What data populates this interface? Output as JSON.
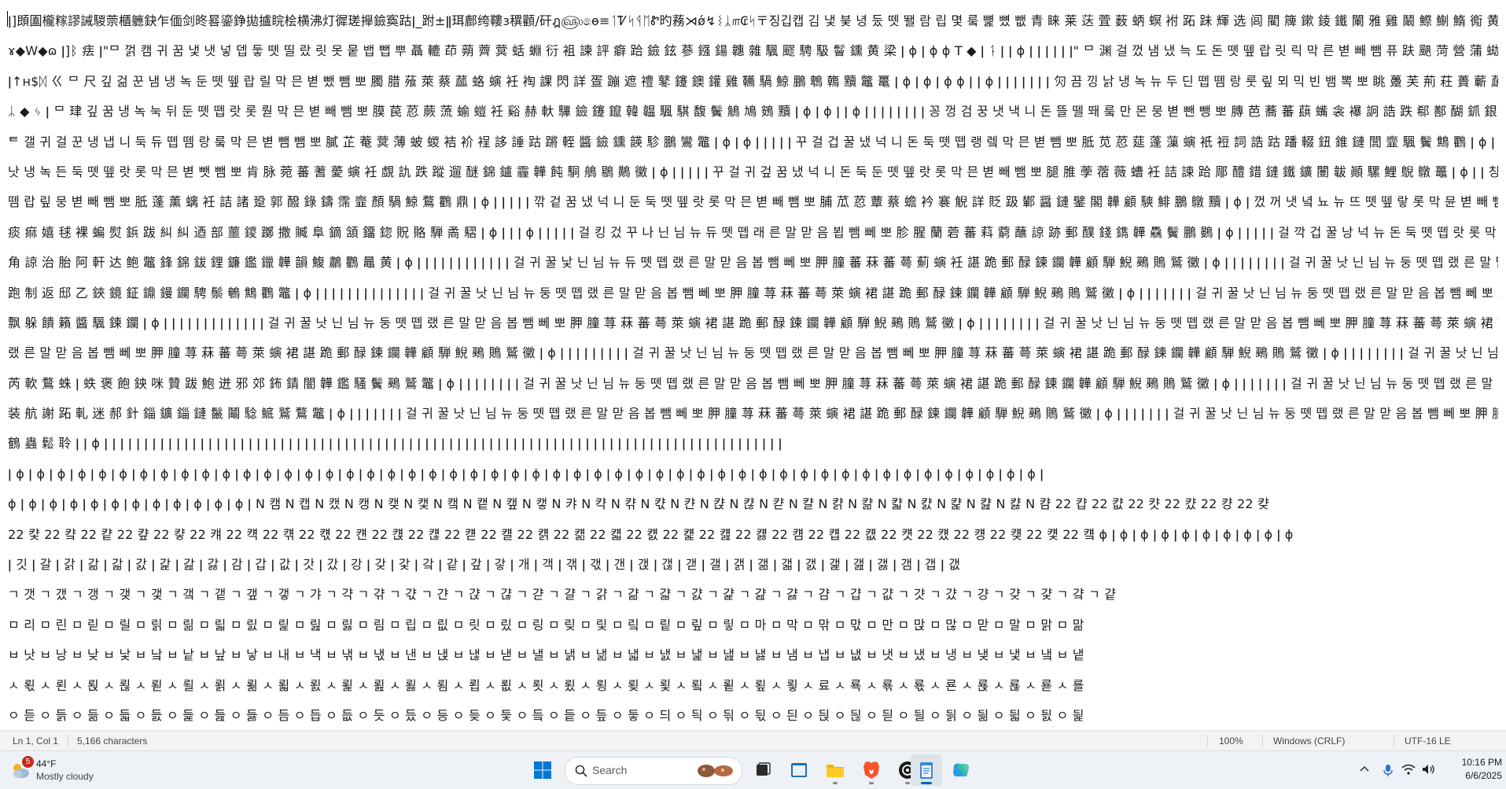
{
  "editor": {
    "lines": [
      "ǀ]䫀圔櫳糘謬誡騣萗櫃軈鈌乍偭剑昸晷鎏錚拋攎睆桧横沸灯徲瑳攑鐱寏跍ǀ_跗±ǁ珥鄜绔鞻ɜ穓顴/矸ฎ௵෧ɵ≡ᛐᏤᛋᛩᛖᏑ旳蓩⋊ǿ↯ᛵᛣ௱₢ᛋ〒징깁캡 김 냋 붖 녕 둤 뗏 뙐 람 립 몇 뤀 뼕 뼜 뺎 青 睐 莱 荙 萓 薮 蛃 螟 袝 跖 跊 輝 选 闾 閵 簰 鏉 錂 鐵 閳 雅 雞 鬫 鰶 鯯 鰖 鵆 黄 峡 ɸ ǀ ǿ ǿ ɸ",
      "ɤ◆W◆ɷ ǀ]ᛒ 㾀 ǀ\"ᄆ 껅 캠 귀 꿈 냋 냇 넣 뎁 둫 뗏 띨 랐 릿 못 뭍 뱁 뺍 뿌 聶 轆 茚 蒴 薺 蓂 蛞 蜵 衍 袓 諫 評 癖 跲 鐱 鉉 蔘 鏹 鍚 韢 雜 颿 飂 騁 馺 鬙 鑂 黄 梁 ǀ ɸ ǀ ɸ ɸ T ◆ ǀ ᛑ ǀ ǀ ɸ ǀ ǀ ǀ ǀ ǀ ǀ\" ᄆ 渊 걸 껐 냄 냈 늑 도 돈 뗏 뗖 랍 릿 릭 막 른 볃 빼 뺌 퓨 趺 颶 菏 營 蒲 蜐 蝂 婐 衾 裮 週 郙 諄 新 蹯 鈊 錦 鍜 雅 鐮 颿 騏 鬟 鶈 鷄 黔 稀",
      "ǀ↑ʜ$ᛞ ㄍ ᄆ 尺 깊 걺 꾼 냄 냉 녹 둔 뗏 뗖 랍 릴 막 믄 볃 뺐 뺌 뽀 臅 腊 蕵 萊 蔡 蓏 蛒 螾 衽 裪 課 閃 詳 疍 蹦 遮 禮 鼕 鑳 鐭 鑵 雞 韉 騧 鯨 鵬 鵯 鶾 黷 鼈 鼍 ǀ ɸ ǀ ɸ ǀ ɸ ɸ ǀ ǀ ɸ ǀ ǀ ǀ ǀ ǀ ǀ ǀ 灳 끔 낑 낡 냉 녹 뉴 두 딘 뗍 뗌 랑 룻 맆 뫼 믹 빈 뱀 뽁 뽀 眺 躉 芙 荊 荰 蕢 蘄 蓏 蝵 衲 讁 謹 謝 賛 趄 跨 軏 鐼 镞 鏇 鐫 閣 驊 韡 餺 鯛 鸚 鱝 鳥 黶 ǀ ɸ ǀ ɸ ǀ",
      "ᛦ ◆ ᛃ ǀ ᄆ 珒 깊 꿈 냉 녹 눅 뒤 둔 뗏 뗍 랏 롯 뤋 막 믄 볃 빼 뺌 뽀 膜 苠 荵 蕨 蓅 蝓 螘 衽 谿 赫 軑 驆 鐱 鑳 鑹 韓 韞 颿 騏 馥 鬢 鵤 鳩 鴳 黷 ǀ ɸ ǀ ɸ ǀ ǀ ɸ ǀ ǀ ǀ ǀ ǀ ǀ ǀ ǀ 꽁 껑 검 꿍 냇 낵 니 돈 뜰 뗄 뙈 뤀 만 몬 뭉 볃 뺀 뺑 뽀 膞 芭 蕎 蕃 蕻 蟕 衾 襮 詗 誥 跌 郗 鄯 醐 釽 銀 錬 鑅 閭 韡 顚 駒 鯬 鴉 鵷 黏 ǀ ɸ ǀ ɸ ǀ",
      "ᄐ 갤 귀 걸 꾼 냉 냅 니 둑 듀 뗍 뗌 랑 뤀 막 믄 볃 뺌 뺌 뽀 膩 芷 菴 蓂 薄 蚾 蝬 袺 衸 裎 誃 諈 跍 蹡 輊 醬 鐱 鑂 韺 駗 鵬 鸞 鼈 ǀ ɸ ǀ ɸ ǀ ǀ ǀ ǀ ǀ 꾸 걸 겁 꿀 냈 넉 니 돈 둑 뗏 뗍 랭 렠 막 믄 볃 뺌 뽀 胝 苋 荵 莚 蓬 薻 螾 衹 裋 詞 誥 跍 蹯 輟 鈕 錐 鏈 閭 韲 颿 鬢 鷦 鸜 ǀ ɸ ǀ ǀ ǀ ǀ ǀ ǀ ǀ 끌 깍 귀 꿈",
      "낫 냉 녹 든 둑 뗏 뗖 랏 롯 막 믄 볃 뺏 뺌 뽀 肯 脉 菀 蕃 蓍 薆 螾 衽 覷 訅 跌 蹤 遛 醚 錦 鑪 霾 韡 飩 駧 鵃 鶍 鷬 黴 ǀ ɸ ǀ ǀ ǀ ǀ ǀ 꾸 걸 귀 겊 꿈 냈 넉 니 돈 둑 둔 뗏 뗖 랏 롯 막 믄 볃 빼 뺌 뽀 腿 脽 荸 蓿 薇 螬 衽 詰 諫 跲 郮 醴 錯 鏈 鐵 鑛 闦 韍 顚 騾 鯉 鶃 鷻 鼉 ǀ ɸ ǀ ǀ 칭 꿀 겁 깐 낙 녹 뉴 도 등 뗏",
      "뗌 랍 맆 뭉 볃 빼 뺌 뽀 胝 蓬 薰 螭 衽 詰 諸 跫 郭 醱 錄 鑄 霈 韲 顏 騧 鯨 鶩 鸜 鼎 ǀ ɸ ǀ ǀ ǀ ǀ ǀ 깎 겉 꿈 냈 넉 니 둔 둑 뗏 뗖 랏 롯 막 믄 볃 빼 뺌 뽀 脯 苽 荵 蕈 蔡 蟾 衿 褰 觬 詳 貶 趿 鄻 醤 鏈 鐾 閣 韡 顧 騻 鯡 鵬 鷻 黷 ǀ ɸ ǀ 껐 꺼 냇 녘 뇨 뉴 뜨 뗏 뗖 랗 롯 막 뮨 볃 빼 뺌 뽀 膽 腥 菁 蕃 萍 螢 褞 豚 輟 鐱 鑑",
      "痰 痲 嬉 毬 裸 蝙 熨 鋲 跋 糾 糾 迺 部 蘁 鑁 躑 撒 贓 阜 鏑 頷 鐂 鍃 貺 賂 騨 矞 騽 ǀ ɸ ǀ ǀ ǀ ɸ ǀ ǀ ǀ ǀ ǀ 걸 킹 겄 꾸 나 닌 님 뉴 듀 뗏 뗍 래 른 말 맏 음 뵙 뺌 뻬 뽀 胗 腥 蘭 菪 蕃 萪 藭 蘸 諒 跡 郵 醭 錢 鐫 韡 驫 鬢 鵬 鷃 ǀ ɸ ǀ ǀ ǀ ǀ ǀ 걸 깍 겁 꿀 낭 넉 뉴 돈 둑 뗏 뗍 랏 롯 막 믄 볃 빼 뺌 뽀 胝 苠 菽 蓍 蕖 螗 衽 諧 跨 郭 鍪 霸 韉 騾 鴆 鶼 黻",
      "角 諒 治 胎 阿 軒 达 鲍 鼈 鋒 錦 鈸 鋰 鐮 鑑 鑞 韡 韻 鰒 鷫 鸜 鼂 黄 ǀ ɸ ǀ ǀ ǀ ǀ ǀ ǀ ǀ ǀ ǀ ǀ ǀ ǀ 걸 귀 꿀 낯 닌 님 뉴 듀 뗏 뗍 랬 른 말 맏 음 봅 뺌 뻬 뽀 胛 膧 蕃 菻 蕃 蕚 薊 螾 衽 諶 跪 郵 醁 鍊 鑭 韡 顧 騨 鯢 鵐 鵙 鷲 黴 ǀ ɸ ǀ ǀ ǀ ǀ ǀ ǀ ǀ ǀ 걸 귀 꿀 낫 닌 님 뉴 둥 뗏 뗍 랬 른 말 맏 음 봅 뺌 뻬 뽀 胛 膧 荨 菻 蕃 蕚 萊 螾 裙 諶 跪 郵 醁",
      "跑 制 返 邸 乙 鋏 鏡 鉦 鐤 鏝 鑭 騁 鬃 鵪 鷦 鸜 鼈 ǀ ɸ ǀ ǀ ǀ ǀ ǀ ǀ ǀ ǀ ǀ ǀ ǀ ǀ ǀ ǀ 걸 귀 꿀 낫 닌 님 뉴 둥 뗏 뗍 랬 른 말 맏 음 봅 뺌 뻬 뽀 胛 膧 荨 菻 蕃 蕚 萊 螾 裙 諶 跪 郵 醁 鍊 鑭 韡 顧 騨 鯢 鵐 鵙 鷲 黴 ǀ ɸ ǀ ǀ ǀ ǀ ǀ ǀ ǀ 걸 귀 꿀 낫 닌 님 뉴 둥 뗏 뗍 랬 른 말 맏 음 봅 뺌 뻬 뽀 胛 膧 荨 菻 蕃 蕚 萊 螾 裙",
      "飘 躲 饋 籟 醬 颿 鍊 鑭 ǀ ɸ ǀ ǀ ǀ ǀ ǀ ǀ ǀ ǀ ǀ ǀ ǀ ǀ ǀ 걸 귀 꿀 낫 닌 님 뉴 둥 뗏 뗍 랬 른 말 맏 음 봅 뺌 뻬 뽀 胛 膧 荨 菻 蕃 蕚 萊 螾 裙 諶 跪 郵 醁 鍊 鑭 韡 顧 騨 鯢 鵐 鵙 鷲 黴 ǀ ɸ ǀ ǀ ǀ ǀ ǀ ǀ ǀ ǀ 걸 귀 꿀 낫 닌 님 뉴 둥 뗏 뗍 랬 른 말 맏 음 봅 뺌 뻬 뽀 胛 膧 荨 菻 蕃 蕚 萊 螾 裙 諶 跪",
      "랬 른 말 맏 음 봅 뺌 뻬 뽀 胛 膧 荨 菻 蕃 蕚 萊 螾 裙 諶 跪 郵 醁 鍊 鑭 韡 顧 騨 鯢 鵐 鵙 鷲 黴 ǀ ɸ ǀ ǀ ǀ ǀ ǀ ǀ ǀ ǀ ǀ 걸 귀 꿀 낫 닌 님 뉴 둥 뗏 뗍 랬 른 말 맏 음 봅 뺌 뻬 뽀 胛 膧 荨 菻 蕃 蕚 萊 螾 裙 諶 跪 郵 醁 鍊 鑭 韡 顧 騨 鯢 鵐 鵙 鷲 黴 ǀ ɸ ǀ ǀ ǀ ǀ ǀ ǀ ǀ ǀ 걸 귀 꿀 낫 닌 님 뉴 둥 뗏",
      "芮 軟 鶩 蛛 ǀ 蛈 褒 飽 鉠 咪 贊 跋 鮑 迸 邪 郊 鈽 錆 闇 韡 鑑 騷 鬢 鵐 鷲 鼈 ǀ ɸ ǀ ǀ ǀ ǀ ǀ ǀ ǀ ǀ 걸 귀 꿀 낫 닌 님 뉴 둥 뗏 뗍 랬 른 말 맏 음 봅 뺌 뻬 뽀 胛 膧 荨 菻 蕃 蕚 萊 螾 裙 諶 跪 郵 醁 鍊 鑭 韡 顧 騨 鯢 鵐 鵙 鷲 黴 ǀ ɸ ǀ ǀ ǀ ǀ ǀ ǀ ǀ 걸 귀 꿀 낫 닌 님 뉴 둥 뗏 뗍 랬 른 말 맏 음",
      "装 航 謝 跖 軋 迷 郝 針 錙 鑛 錙 鏈 鬣 鬮 騐 鯳 鷲 鶩 鼈 ǀ ɸ ǀ ǀ ǀ ǀ ǀ ǀ ǀ 걸 귀 꿀 낫 닌 님 뉴 둥 뗏 뗍 랬 른 말 맏 음 봅 뺌 뻬 뽀 胛 膧 荨 菻 蕃 蕚 萊 螾 裙 諶 跪 郵 醁 鍊 鑭 韡 顧 騨 鯢 鵐 鵙 鷲 黴 ǀ ɸ ǀ ǀ ǀ ǀ ǀ ǀ ǀ 걸 귀 꿀 낫 닌 님 뉴 둥 뗏 뗍 랬 른 말 맏 음 봅 뺌 뻬 뽀 胛 膧 荨",
      "鶴 蟲 鬆 聆 ǀ ǀ ɸ ǀ ǀ ǀ ǀ ǀ ǀ ǀ ǀ ǀ ǀ ǀ ǀ ǀ ǀ ǀ ǀ ǀ ǀ ǀ ǀ ǀ ǀ ǀ ǀ ǀ ǀ ǀ ǀ ǀ ǀ ǀ ǀ ǀ ǀ ǀ ǀ ǀ ǀ ǀ ǀ ǀ ǀ ǀ ǀ ǀ ǀ ǀ ǀ ǀ ǀ ǀ ǀ ǀ ǀ ǀ ǀ ǀ ǀ ǀ ǀ ǀ ǀ ǀ ǀ ǀ ǀ ǀ ǀ ǀ ǀ ǀ ǀ ǀ ǀ ǀ ǀ ǀ ǀ ǀ ǀ ǀ ǀ ǀ ǀ ǀ",
      "ǀ ɸ ǀ ɸ ǀ ɸ ǀ ɸ ǀ ɸ ǀ ɸ ǀ ɸ ǀ ɸ ǀ ɸ ǀ ɸ ǀ ɸ ǀ ɸ ǀ ɸ ǀ ɸ ǀ ɸ ǀ ɸ ǀ ɸ ǀ ɸ ǀ ɸ ǀ ɸ ǀ ɸ ǀ ɸ ǀ ɸ ǀ ɸ ǀ ɸ ǀ ɸ ǀ ɸ ǀ ɸ ǀ ɸ ǀ ɸ ǀ ɸ ǀ ɸ ǀ ɸ ǀ ɸ ǀ ɸ ǀ ɸ ǀ ɸ ǀ ɸ ǀ ɸ ǀ ɸ ǀ ɸ ǀ ɸ ǀ ɸ ǀ ɸ ǀ ɸ ǀ ɸ ǀ ɸ ǀ ɸ ǀ ɸ ǀ ɸ ǀ",
      "ɸ ǀ ɸ ǀ ɸ ǀ ɸ ǀ ɸ ǀ ɸ ǀ ɸ ǀ ɸ ǀ ɸ ǀ ɸ ǀ ɸ ǀ ɸ ǀ N 캠 N 캡 N 캤 N 캥 N 캦 N 캧 N 캨 N 캩 N 캪 N 캫 N 캬 N 캭 N 캮 N 캯 N 캰 N 캱 N 캲 N 캳 N 캴 N 캵 N 캶 N 캷 N 캸 N 캹 N 캺 N 캻 N 캼 22 캽 22 캾 22 캿 22 컀 22 컁 22 컂",
      "22 컃 22 컄 22 컅 22 컆 22 컇 22 컈 22 컉 22 컊 22 컋 22 컌 22 컍 22 컎 22 컏 22 컐 22 컑 22 컒 22 컓 22 컔 22 컕 22 컖 22 컗 22 컘 22 컙 22 컚 22 컛 22 컜 22 컝 22 컞 22 컟 22 컠 ɸ ǀ ɸ ǀ ɸ ǀ ɸ ǀ ɸ ǀ ɸ ǀ ɸ ǀ ɸ ǀ ɸ ǀ ɸ",
      "ǀ 깃 ǀ 갈 ǀ 갉 ǀ 갊 ǀ 갋 ǀ 갌 ǀ 갍 ǀ 갎 ǀ 갏 ǀ 감 ǀ 갑 ǀ 값 ǀ 갓 ǀ 갔 ǀ 강 ǀ 갖 ǀ 갗 ǀ 갘 ǀ 같 ǀ 갚 ǀ 갛 ǀ 개 ǀ 객 ǀ 갞 ǀ 갟 ǀ 갠 ǀ 갡 ǀ 갢 ǀ 갣 ǀ 갤 ǀ 갥 ǀ 갦 ǀ 갧 ǀ 갨 ǀ 갩 ǀ 갪 ǀ 갫 ǀ 갬 ǀ 갭 ǀ 갮",
      "ㄱ 갯 ㄱ 갰 ㄱ 갱 ㄱ 갲 ㄱ 갳 ㄱ 갴 ㄱ 갵 ㄱ 갶 ㄱ 갷 ㄱ 갸 ㄱ 갹 ㄱ 갺 ㄱ 갻 ㄱ 갼 ㄱ 갽 ㄱ 갾 ㄱ 갿 ㄱ 걀 ㄱ 걁 ㄱ 걂 ㄱ 걃 ㄱ 걄 ㄱ 걅 ㄱ 걆 ㄱ 걇 ㄱ 걈 ㄱ 걉 ㄱ 걊 ㄱ 걋 ㄱ 걌 ㄱ 걍 ㄱ 걎 ㄱ 걏 ㄱ 걐 ㄱ 걑",
      "ㅁ 리 ㅁ 린 ㅁ 릳 ㅁ 릴 ㅁ 릵 ㅁ 릶 ㅁ 릷 ㅁ 릸 ㅁ 릹 ㅁ 릺 ㅁ 릻 ㅁ 림 ㅁ 립 ㅁ 릾 ㅁ 릿 ㅁ 맀 ㅁ 링 ㅁ 맂 ㅁ 맃 ㅁ 맄 ㅁ 맅 ㅁ 맆 ㅁ 맇 ㅁ 마 ㅁ 막 ㅁ 맊 ㅁ 맋 ㅁ 만 ㅁ 맍 ㅁ 많 ㅁ 맏 ㅁ 말 ㅁ 맑 ㅁ 맒",
      "ㅂ 낫 ㅂ 낭 ㅂ 낮 ㅂ 낯 ㅂ 낰 ㅂ 낱 ㅂ 낲 ㅂ 낳 ㅂ 내 ㅂ 낵 ㅂ 낶 ㅂ 낷 ㅂ 낸 ㅂ 낹 ㅂ 낺 ㅂ 낻 ㅂ 낼 ㅂ 낽 ㅂ 낾 ㅂ 낿 ㅂ 냀 ㅂ 냁 ㅂ 냂 ㅂ 냃 ㅂ 냄 ㅂ 냅 ㅂ 냆 ㅂ 냇 ㅂ 냈 ㅂ 냉 ㅂ 냊 ㅂ 냋 ㅂ 냌 ㅂ 냍",
      "ㅅ 뢳 ㅅ 뢴 ㅅ 뢵 ㅅ 뢶 ㅅ 뢷 ㅅ 뢸 ㅅ 뢹 ㅅ 뢺 ㅅ 뢻 ㅅ 뢼 ㅅ 뢽 ㅅ 뢾 ㅅ 뢿 ㅅ 룀 ㅅ 룁 ㅅ 룂 ㅅ 룃 ㅅ 룄 ㅅ 룅 ㅅ 룆 ㅅ 룇 ㅅ 룈 ㅅ 룉 ㅅ 룊 ㅅ 룋 ㅅ 료 ㅅ 룍 ㅅ 룎 ㅅ 룏 ㅅ 룐 ㅅ 룑 ㅅ 룒 ㅅ 룓 ㅅ 룔",
      "ㅇ 듣 ㅇ 듥 ㅇ 듦 ㅇ 듧 ㅇ 듨 ㅇ 듩 ㅇ 듪 ㅇ 듫 ㅇ 듬 ㅇ 듭 ㅇ 듮 ㅇ 듯 ㅇ 듰 ㅇ 등 ㅇ 듲 ㅇ 듳 ㅇ 듴 ㅇ 듵 ㅇ 듶 ㅇ 듷 ㅇ 듸 ㅇ 듹 ㅇ 듺 ㅇ 듻 ㅇ 듼 ㅇ 듽 ㅇ 듾 ㅇ 듿 ㅇ 딀 ㅇ 딁 ㅇ 딂 ㅇ 딃 ㅇ 딄 ㅇ 딅"
    ]
  },
  "status_bar": {
    "position": "Ln 1, Col 1",
    "characters": "5,166 characters",
    "zoom": "100%",
    "line_ending": "Windows (CRLF)",
    "encoding": "UTF-16 LE"
  },
  "taskbar": {
    "weather": {
      "badge": "5",
      "temperature": "44°F",
      "condition": "Mostly cloudy",
      "icon": "cloud-sun-icon"
    },
    "search_label": "Search",
    "apps": [
      {
        "name": "start-button",
        "icon": "windows-logo-icon"
      },
      {
        "name": "task-view-button",
        "icon": "task-view-icon"
      },
      {
        "name": "app-window-button",
        "icon": "window-icon"
      },
      {
        "name": "file-explorer-button",
        "icon": "folder-icon"
      },
      {
        "name": "brave-browser-button",
        "icon": "brave-lion-icon"
      },
      {
        "name": "chatgpt-button",
        "icon": "openai-icon"
      },
      {
        "name": "notepad-button",
        "icon": "notepad-icon"
      },
      {
        "name": "copilot-button",
        "icon": "copilot-icon"
      }
    ],
    "clock": {
      "time": "10:16 PM",
      "date": "6/6/2025"
    },
    "accent_color": "#0067c0"
  }
}
